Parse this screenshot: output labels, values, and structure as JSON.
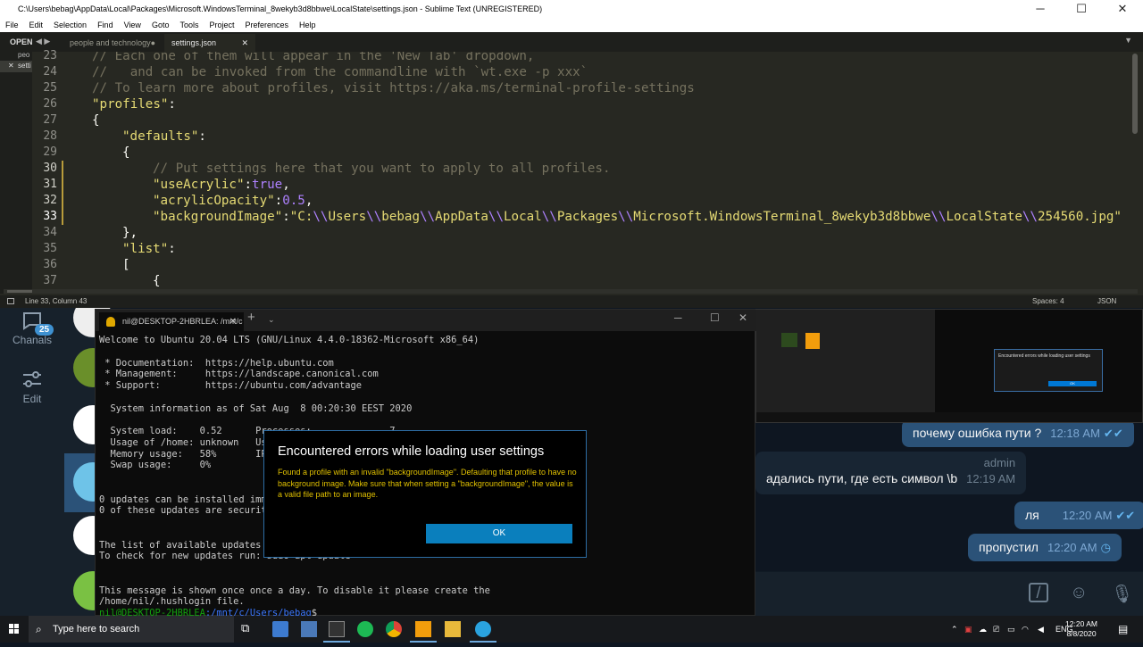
{
  "sublime": {
    "window_title": "C:\\Users\\bebag\\AppData\\Local\\Packages\\Microsoft.WindowsTerminal_8wekyb3d8bbwe\\LocalState\\settings.json - Sublime Text (UNREGISTERED)",
    "menu": [
      "File",
      "Edit",
      "Selection",
      "Find",
      "View",
      "Goto",
      "Tools",
      "Project",
      "Preferences",
      "Help"
    ],
    "sidebar_label": "OPEN",
    "sidebar_files": [
      "peo",
      "setti"
    ],
    "tabs": [
      {
        "label": "people and technology",
        "dirty_marker": "●"
      },
      {
        "label": "settings.json",
        "close": "✕"
      }
    ],
    "line_numbers": [
      "23",
      "24",
      "25",
      "26",
      "27",
      "28",
      "29",
      "30",
      "31",
      "32",
      "33",
      "34",
      "35",
      "36",
      "37"
    ],
    "code": {
      "l23": "// Each one of them will appear in the 'New Tab' dropdown,",
      "l24": "//   and can be invoked from the commandline with `wt.exe -p xxx`",
      "l25": "// To learn more about profiles, visit https://aka.ms/terminal-profile-settings",
      "l26_key": "\"profiles\"",
      "l27": "{",
      "l28_key": "\"defaults\"",
      "l29": "{",
      "l30": "// Put settings here that you want to apply to all profiles.",
      "l31_key": "\"useAcrylic\"",
      "l31_val": "true",
      "l32_key": "\"acrylicOpacity\"",
      "l32_val": "0.5",
      "l33_key": "\"backgroundImage\"",
      "l33_parts": [
        "\"C:",
        "\\\\",
        "Users",
        "\\\\",
        "bebag",
        "\\\\",
        "AppData",
        "\\\\",
        "Local",
        "\\\\",
        "Packages",
        "\\\\",
        "Microsoft.WindowsTerminal_8wekyb3d8bbwe",
        "\\\\",
        "LocalState",
        "\\\\",
        "254560.jpg\""
      ],
      "l34": "},",
      "l35_key": "\"list\"",
      "l36": "[",
      "l37": "{"
    },
    "status_left": "Line 33, Column 43",
    "status_spaces": "Spaces: 4",
    "status_syntax": "JSON"
  },
  "terminal": {
    "tab_title": "nil@DESKTOP-2HBRLEA: /mnt/c",
    "lines": [
      "Welcome to Ubuntu 20.04 LTS (GNU/Linux 4.4.0-18362-Microsoft x86_64)",
      "",
      " * Documentation:  https://help.ubuntu.com",
      " * Management:     https://landscape.canonical.com",
      " * Support:        https://ubuntu.com/advantage",
      "",
      "  System information as of Sat Aug  8 00:20:30 EEST 2020",
      "",
      "  System load:    0.52      Processes:              7",
      "  Usage of /home: unknown   Users logged in:        0",
      "  Memory usage:   58%       IPv4 address for eth0:",
      "  Swap usage:     0%",
      "",
      "",
      "0 updates can be installed immediately.",
      "0 of these updates are security updates.",
      "",
      "",
      "The list of available updates is more than a week old.",
      "To check for new updates run: sudo apt update",
      "",
      "",
      "This message is shown once once a day. To disable it please create the",
      "/home/nil/.hushlogin file."
    ],
    "prompt_user": "nil@DESKTOP-2HBRLEA",
    "prompt_path": ":/mnt/c/Users/bebag",
    "prompt_symbol": "$"
  },
  "dialog": {
    "title": "Encountered errors while loading user settings",
    "message": "Found a profile with an invalid \"backgroundImage\". Defaulting that profile to have no background image. Make sure that when setting a \"backgroundImage\", the value is a valid file path to an image.",
    "ok": "OK"
  },
  "telegram": {
    "badge": "25",
    "chanals_label": "Chanals",
    "edit_label": "Edit",
    "messages": [
      {
        "text": "почему ошибка пути ?",
        "time": "12:18 AM",
        "dir": "out",
        "status": "read"
      },
      {
        "author": "admin",
        "text": "адались пути, где есть символ \\b",
        "time": "12:19 AM",
        "dir": "in"
      },
      {
        "text": "ля",
        "time": "12:20 AM",
        "dir": "out",
        "status": "read"
      },
      {
        "text": "пропустил",
        "time": "12:20 AM",
        "dir": "out",
        "status": "pending"
      }
    ]
  },
  "thumbnail": {
    "dialog_title": "Encountered errors while loading user settings",
    "ok": "OK"
  },
  "taskbar": {
    "search_placeholder": "Type here to search",
    "language": "ENG",
    "time": "12:20 AM",
    "date": "8/8/2020"
  },
  "colors": {
    "sublime_bg": "#272822",
    "telegram_bg": "#0e1621",
    "accent_blue": "#0a7fbd",
    "warning_yellow": "#e0c000"
  }
}
